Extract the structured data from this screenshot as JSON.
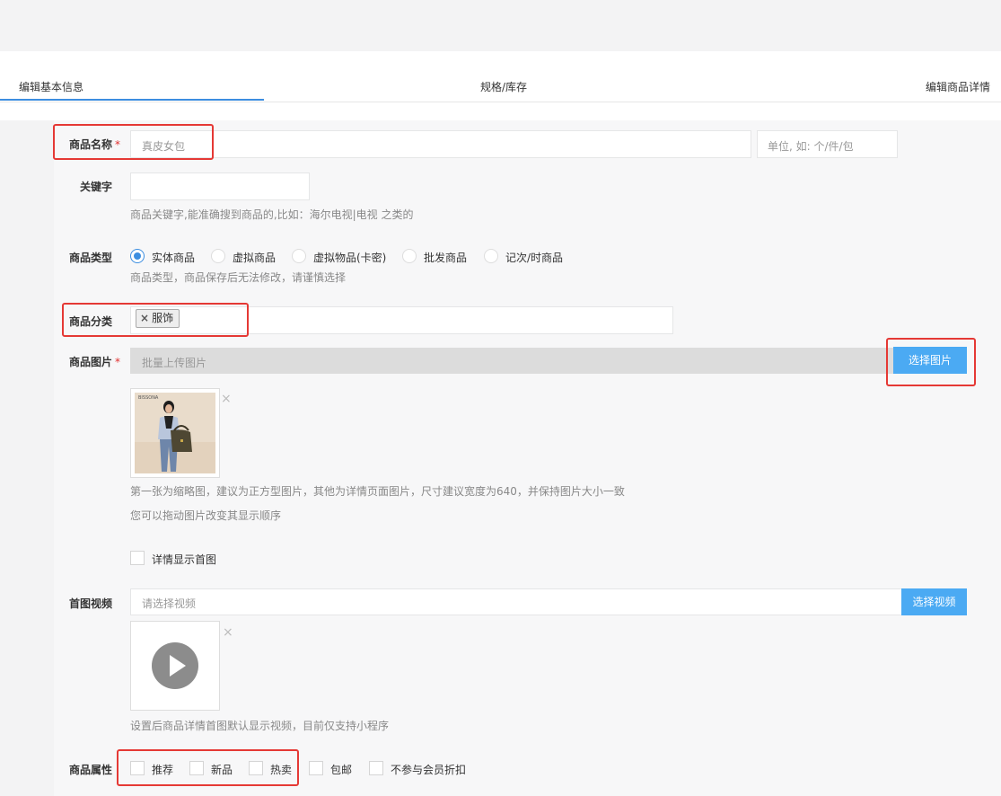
{
  "tabs": {
    "basic": "编辑基本信息",
    "spec": "规格/库存",
    "detail": "编辑商品详情"
  },
  "form": {
    "name": {
      "label": "商品名称",
      "required": "*",
      "placeholder": "真皮女包",
      "unit_placeholder": "单位, 如: 个/件/包"
    },
    "keyword": {
      "label": "关键字",
      "help": "商品关键字,能准确搜到商品的,比如：海尔电视|电视 之类的"
    },
    "type": {
      "label": "商品类型",
      "options": [
        "实体商品",
        "虚拟商品",
        "虚拟物品(卡密)",
        "批发商品",
        "记次/时商品"
      ],
      "selected": "实体商品",
      "help": "商品类型，商品保存后无法修改，请谨慎选择"
    },
    "category": {
      "label": "商品分类",
      "tag": "服饰",
      "tag_remove": "×"
    },
    "images": {
      "label": "商品图片",
      "required": "*",
      "placeholder": "批量上传图片",
      "button": "选择图片",
      "thumb_brand": "BISSONA",
      "remove": "×",
      "help1": "第一张为缩略图，建议为正方型图片，其他为详情页面图片，尺寸建议宽度为640，并保持图片大小一致",
      "help2": "您可以拖动图片改变其显示顺序",
      "show_first": "详情显示首图"
    },
    "video": {
      "label": "首图视频",
      "placeholder": "请选择视频",
      "button": "选择视频",
      "remove": "×",
      "help": "设置后商品详情首图默认显示视频，目前仅支持小程序"
    },
    "attrs": {
      "label": "商品属性",
      "options": [
        "推荐",
        "新品",
        "热卖",
        "包邮",
        "不参与会员折扣"
      ]
    }
  },
  "colors": {
    "accent": "#3c8ee0",
    "button": "#4baaf3",
    "highlight": "#e53935",
    "required": "#e0302f"
  }
}
